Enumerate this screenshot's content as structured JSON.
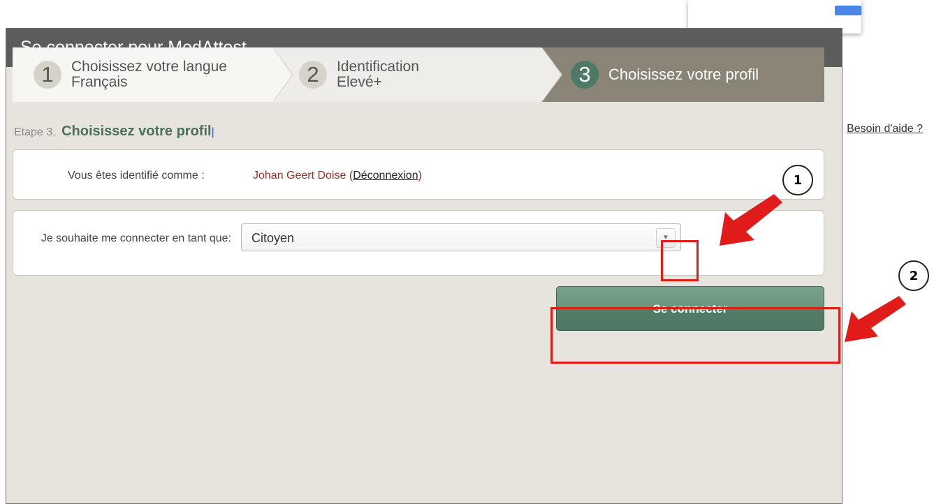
{
  "dialog": {
    "title": "Se connecter pour MedAttest"
  },
  "steps": [
    {
      "number": "1",
      "title": "Choisissez votre langue",
      "value": "Français"
    },
    {
      "number": "2",
      "title": "Identification",
      "value": "Elevé+"
    },
    {
      "number": "3",
      "title": "Choisissez votre profil"
    }
  ],
  "stage": {
    "prefix": "Etape 3.",
    "title": "Choisissez votre profil",
    "help_link": "Besoin d'aide ?"
  },
  "identity": {
    "label": "Vous êtes identifié comme :",
    "user_name": "Johan Geert Doise",
    "logout_link": "Déconnexion"
  },
  "profile": {
    "label": "Je souhaite me connecter en tant que:",
    "selected": "Citoyen"
  },
  "actions": {
    "connect_label": "Se connecter"
  },
  "annotations": {
    "badge_1": "1",
    "badge_2": "2",
    "highlight_color": "#e11a1a"
  }
}
